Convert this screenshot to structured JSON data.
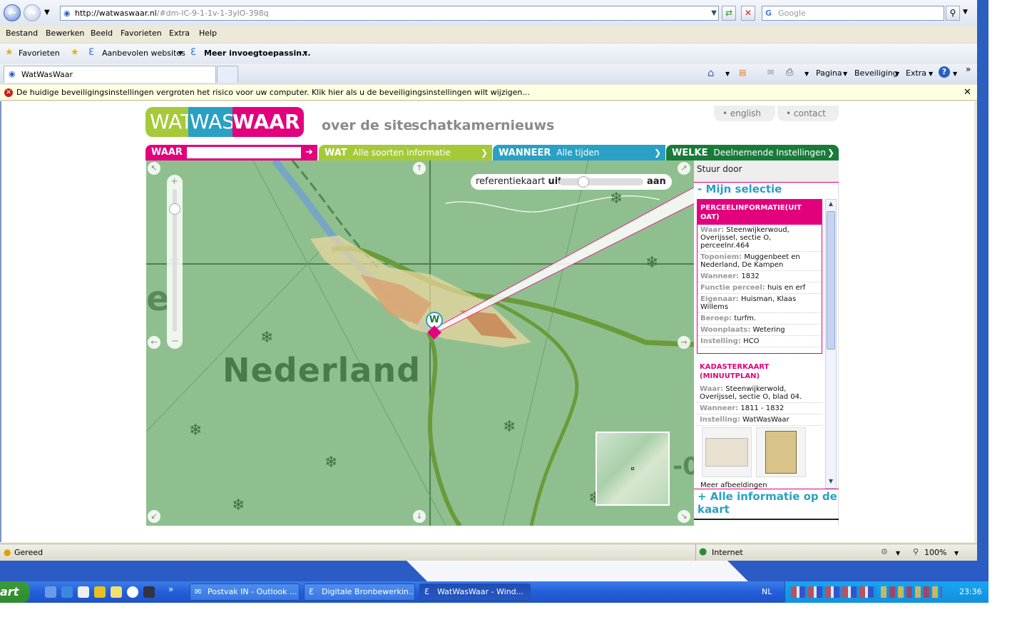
{
  "browser": {
    "url_domain": "http://watwaswaar.nl",
    "url_rest": "/#dm-lC-9-1-1v-1-3ylO-398q",
    "search_placeholder": "Google",
    "menu": [
      "Bestand",
      "Bewerken",
      "Beeld",
      "Favorieten",
      "Extra",
      "Help"
    ],
    "favorites_label": "Favorieten",
    "recommended_label": "Aanbevolen websites",
    "more_addons_label": "Meer invoegtoepassin...",
    "tab_title": "WatWasWaar",
    "commands": {
      "pagina": "Pagina",
      "beveiliging": "Beveiliging",
      "extra": "Extra"
    },
    "security_warning": "De huidige beveiligingsinstellingen vergroten het risico voor uw computer. Klik hier als u de beveiligingsinstellingen wilt wijzigen...",
    "status": {
      "ready": "Gereed",
      "zone": "Internet",
      "zoom": "100%"
    }
  },
  "site": {
    "logo": {
      "part1": "WAT",
      "part2": "WAS",
      "part3": "WAAR"
    },
    "nav": [
      "over de site",
      "schatkamer",
      "nieuws"
    ],
    "toplinks": [
      "english",
      "contact"
    ],
    "filters": {
      "waar": {
        "label": "WAAR"
      },
      "wat": {
        "label": "WAT",
        "value": "Alle soorten informatie"
      },
      "wanneer": {
        "label": "WANNEER",
        "value": "Alle tijden"
      },
      "welke": {
        "label": "WELKE",
        "value": "Deelnemende Instellingen"
      }
    },
    "map": {
      "place_label": "Nederland",
      "reference_label": "referentiekaart",
      "ref_off": "uit",
      "ref_on": "aan",
      "marker": "W",
      "reference_slider_position": 0.25
    },
    "panel": {
      "send_label": "Stuur door",
      "my_selection": "- Mijn selectie",
      "card1": {
        "title": "PERCEELINFORMATIE(UIT OAT)",
        "rows": [
          {
            "k": "Waar:",
            "v": "Steenwijkerwoud, Overijssel, sectie O, perceelnr.464"
          },
          {
            "k": "Toponiem:",
            "v": "Muggenbeet en Nederland, De Kampen"
          },
          {
            "k": "Wanneer:",
            "v": "1832"
          },
          {
            "k": "Functie perceel:",
            "v": "huis en erf"
          },
          {
            "k": "Eigenaar:",
            "v": "Huisman, Klaas Willems"
          },
          {
            "k": "Beroep:",
            "v": "turfm."
          },
          {
            "k": "Woonplaats:",
            "v": "Wetering"
          },
          {
            "k": "Instelling:",
            "v": "HCO"
          }
        ]
      },
      "card2": {
        "title": "KADASTERKAART (MINUUTPLAN)",
        "rows": [
          {
            "k": "Waar:",
            "v": "Steenwijkerwold, Overijssel, sectie O, blad 04."
          },
          {
            "k": "Wanneer:",
            "v": "1811 - 1832"
          },
          {
            "k": "Instelling:",
            "v": "WatWasWaar"
          }
        ],
        "more_images": "Meer afbeeldingen"
      },
      "all_info": "+ Alle informatie op de kaart"
    }
  },
  "taskbar": {
    "start": "art",
    "buttons": [
      "Postvak IN - Outlook ...",
      "Digitale Bronbewerkin...",
      "WatWasWaar - Wind..."
    ],
    "lang": "NL",
    "clock": "23:36"
  },
  "colors": {
    "wat_green": "#a6c93a",
    "waar_pink": "#e3007d",
    "wanneer_blue": "#2aa0c4",
    "welke_green": "#1a7a3a",
    "map_green": "#8fbf8f"
  }
}
